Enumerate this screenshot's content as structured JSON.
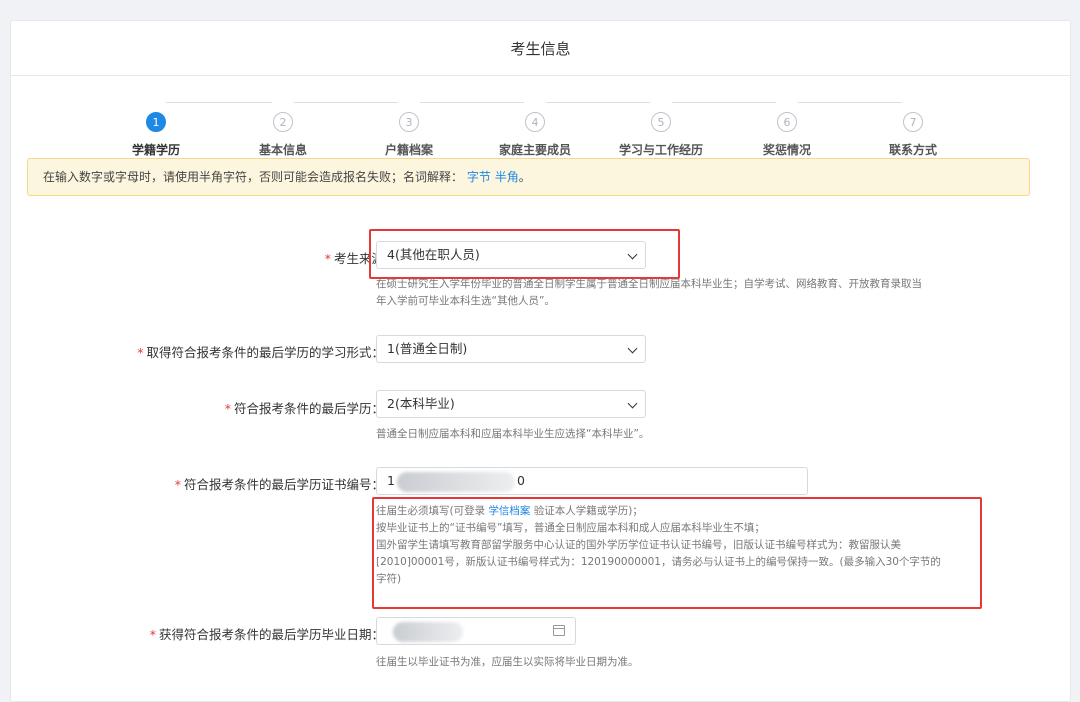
{
  "page": {
    "title": "考生信息"
  },
  "steps": [
    {
      "num": "1",
      "label": "学籍学历",
      "active": true
    },
    {
      "num": "2",
      "label": "基本信息",
      "active": false
    },
    {
      "num": "3",
      "label": "户籍档案",
      "active": false
    },
    {
      "num": "4",
      "label": "家庭主要成员",
      "active": false
    },
    {
      "num": "5",
      "label": "学习与工作经历",
      "active": false
    },
    {
      "num": "6",
      "label": "奖惩情况",
      "active": false
    },
    {
      "num": "7",
      "label": "联系方式",
      "active": false
    }
  ],
  "notice": {
    "text": "在输入数字或字母时，请使用半角字符，否则可能会造成报名失败；名词解释：",
    "link1": "字节",
    "link2": "半角",
    "end": "。"
  },
  "form": {
    "source": {
      "label": "考生来源",
      "value": "4(其他在职人员)",
      "help_line1": "在硕士研究生入学年份毕业的普通全日制学生属于普通全日制应届本科毕业生；自学考试、网络教育、开放教育录取当",
      "help_line2": "年入学前可毕业本科生选“其他人员”。"
    },
    "study_form": {
      "label": "取得符合报考条件的最后学历的学习形式：",
      "value": "1(普通全日制)"
    },
    "last_degree": {
      "label": "符合报考条件的最后学历：",
      "value": "2(本科毕业)",
      "help": "普通全日制应届本科和应届本科毕业生应选择“本科毕业”。"
    },
    "cert_no": {
      "label": "符合报考条件的最后学历证书编号：",
      "value_start": "1",
      "value_end": "0",
      "help_pre": "往届生必须填写(可登录 ",
      "help_link": "学信档案",
      "help_post": " 验证本人学籍或学历)；",
      "help_line2": "按毕业证书上的“证书编号”填写，普通全日制应届本科和成人应届本科毕业生不填；",
      "help_line3": "国外留学生请填写教育部留学服务中心认证的国外学历学位证书认证书编号，旧版认证书编号样式为：教留服认美",
      "help_line4": "[2010]00001号，新版认证书编号样式为：120190000001，请务必与认证书上的编号保持一致。(最多输入30个字节的",
      "help_line5": "字符)"
    },
    "grad_date": {
      "label": "获得符合报考条件的最后学历毕业日期：",
      "help": "往届生以毕业证书为准，应届生以实际将毕业日期为准。"
    }
  },
  "colors": {
    "primary": "#1e88e5",
    "required": "#e53935",
    "notice_bg": "#fdf6df",
    "highlight_box": "#e53935"
  }
}
